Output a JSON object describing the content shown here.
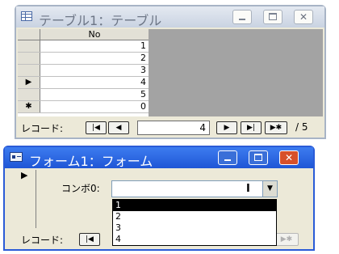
{
  "table_window": {
    "title": "テーブル1：テーブル",
    "title_icon": "table-icon",
    "column_header": "No",
    "rows": [
      {
        "selector": "",
        "value": "1"
      },
      {
        "selector": "",
        "value": "2"
      },
      {
        "selector": "",
        "value": "3"
      },
      {
        "selector": "▶",
        "value": "4"
      },
      {
        "selector": "",
        "value": "5"
      },
      {
        "selector": "✱",
        "value": "0"
      }
    ],
    "record_label": "レコード:",
    "current_record": "4",
    "total_records": "/ 5"
  },
  "form_window": {
    "title": "フォーム1：フォーム",
    "title_icon": "form-icon",
    "combo_label": "コンボ0:",
    "combo_options": [
      "1",
      "2",
      "3",
      "4"
    ],
    "selected_option_index": 0,
    "record_label": "レコード:"
  }
}
